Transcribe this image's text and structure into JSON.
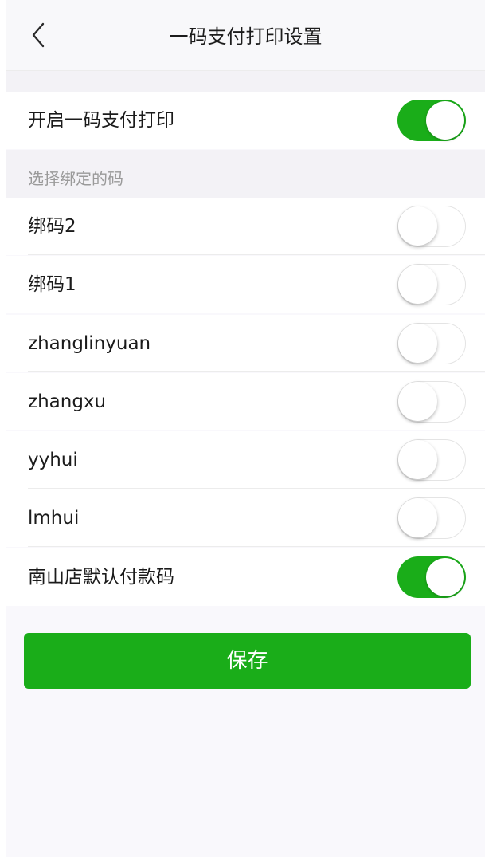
{
  "header": {
    "title": "一码支付打印设置",
    "back_icon": "chevron-left-icon"
  },
  "master_toggle": {
    "label": "开启一码支付打印",
    "on": true
  },
  "section": {
    "label": "选择绑定的码"
  },
  "codes": [
    {
      "label": "绑码2",
      "on": false
    },
    {
      "label": "绑码1",
      "on": false
    },
    {
      "label": "zhanglinyuan",
      "on": false
    },
    {
      "label": "zhangxu",
      "on": false
    },
    {
      "label": "yyhui",
      "on": false
    },
    {
      "label": "lmhui",
      "on": false
    },
    {
      "label": "南山店默认付款码",
      "on": true
    }
  ],
  "save_button": {
    "label": "保存"
  },
  "colors": {
    "accent": "#1aad19",
    "background": "#f9f8fc",
    "divider": "#ececec"
  }
}
